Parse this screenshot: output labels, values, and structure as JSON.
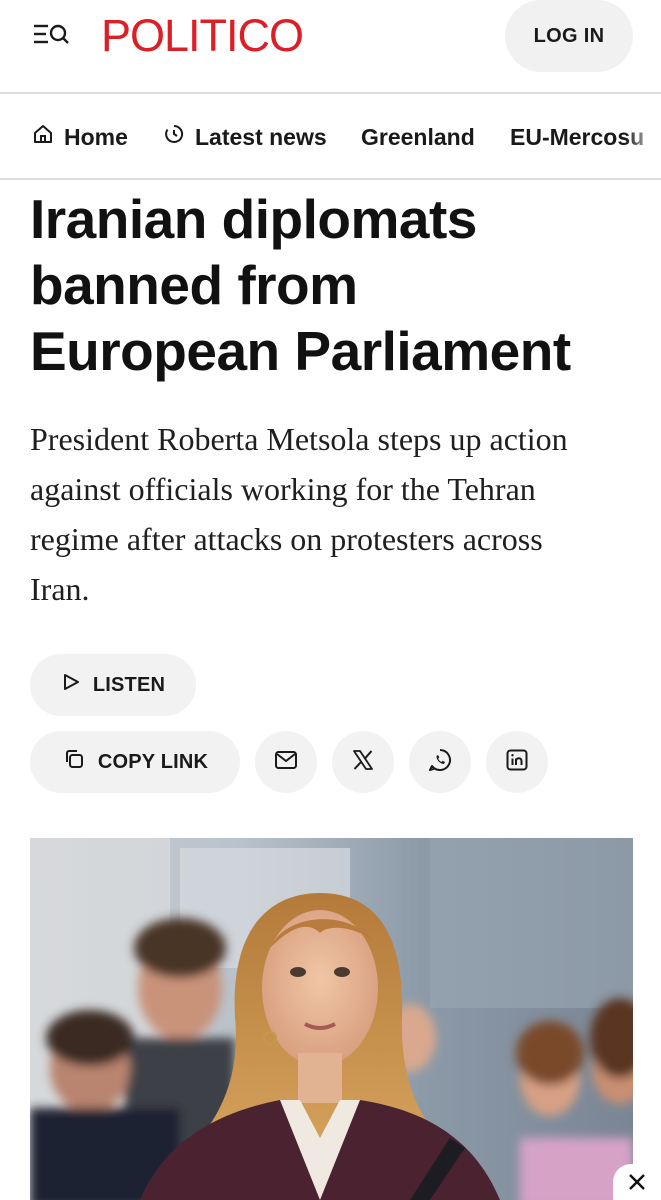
{
  "header": {
    "logo": "POLITICO",
    "login_label": "LOG IN",
    "menu_icon": "menu-search-icon",
    "logo_color": "#dc1f26"
  },
  "nav": {
    "items": [
      {
        "label": "Home",
        "icon": "home-icon"
      },
      {
        "label": "Latest news",
        "icon": "clock-icon"
      },
      {
        "label": "Greenland"
      },
      {
        "label": "EU-Mercosu"
      }
    ]
  },
  "article": {
    "headline_lines": [
      "Iranian diplomats",
      "banned from",
      "European Parliament"
    ],
    "dek_lines": [
      "President Roberta Metsola steps up action",
      "against officials working for the Tehran",
      "regime after attacks on protesters across",
      "Iran."
    ]
  },
  "actions": {
    "listen_label": "LISTEN",
    "copy_link_label": "COPY LINK",
    "share_icons": [
      "email-icon",
      "x-icon",
      "whatsapp-icon",
      "linkedin-icon"
    ]
  },
  "close_icon": "close-icon"
}
